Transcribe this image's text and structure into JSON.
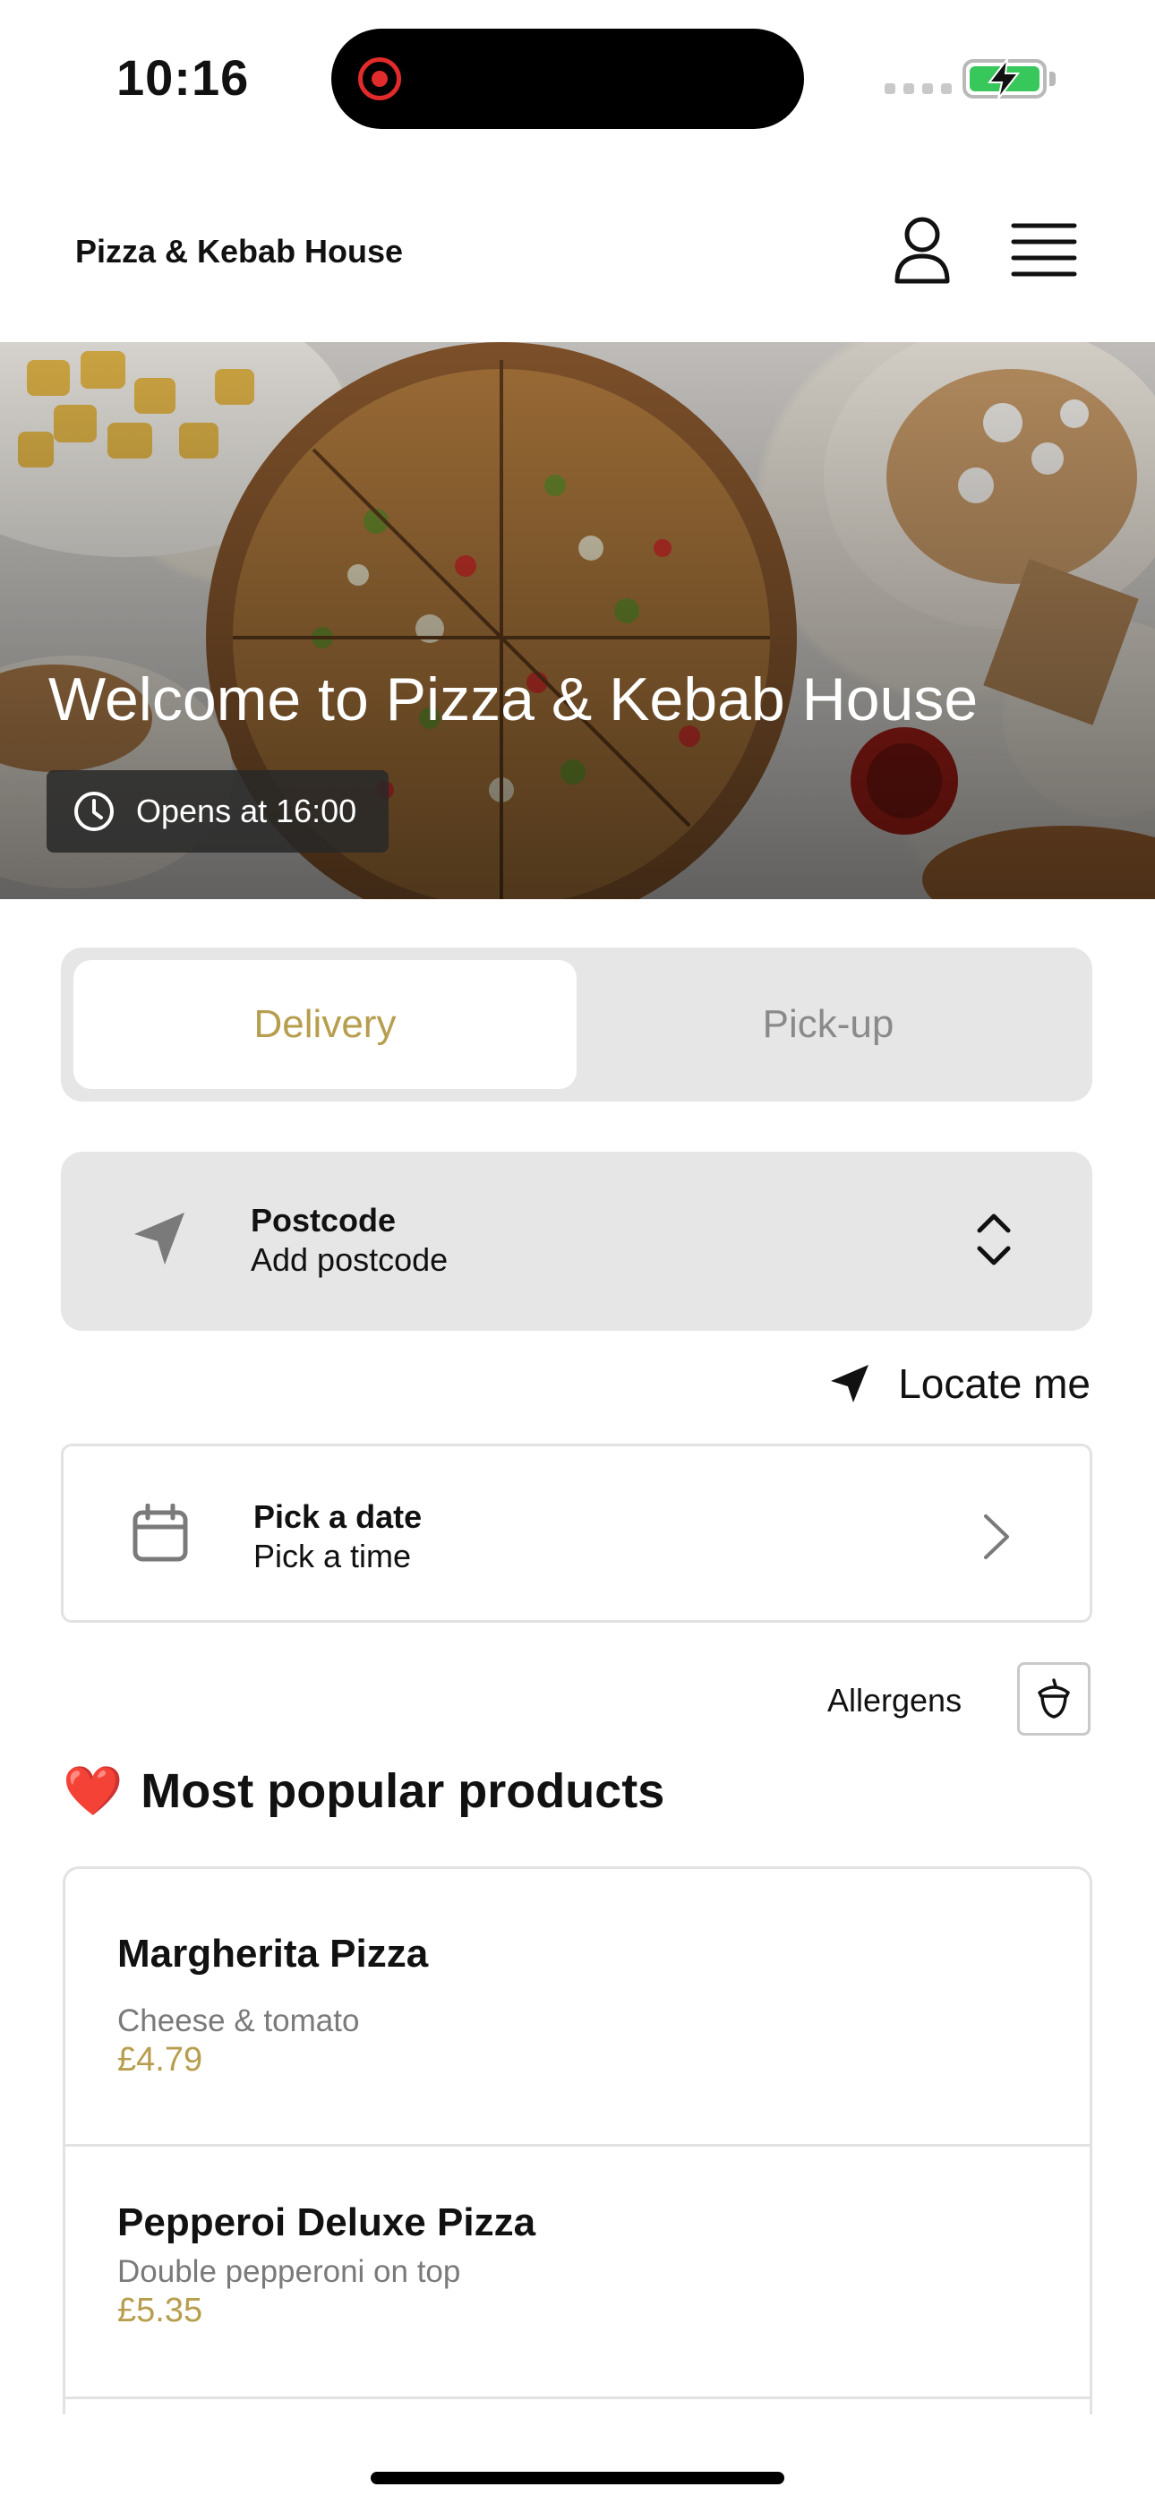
{
  "status_bar": {
    "time": "10:16"
  },
  "header": {
    "brand": "Pizza & Kebab House"
  },
  "hero": {
    "title": "Welcome to Pizza & Kebab House",
    "opens": "Opens at 16:00"
  },
  "mode_toggle": {
    "delivery": "Delivery",
    "pickup": "Pick-up",
    "selected": "Delivery"
  },
  "postcode": {
    "label": "Postcode",
    "value": "Add postcode"
  },
  "locate": {
    "label": "Locate me"
  },
  "date_picker": {
    "label": "Pick a date",
    "value": "Pick a time"
  },
  "allergens": {
    "label": "Allergens"
  },
  "popular": {
    "emoji": "❤️",
    "title": "Most popular products",
    "items": [
      {
        "name": "Margherita Pizza",
        "description": "Cheese & tomato",
        "price": "£4.79"
      },
      {
        "name": "Pepperoi Deluxe Pizza",
        "description": "Double pepperoni on top",
        "price": "£5.35"
      }
    ]
  },
  "colors": {
    "accent": "#b79e4e",
    "battery": "#38c75a",
    "recording": "#e22b2b"
  }
}
